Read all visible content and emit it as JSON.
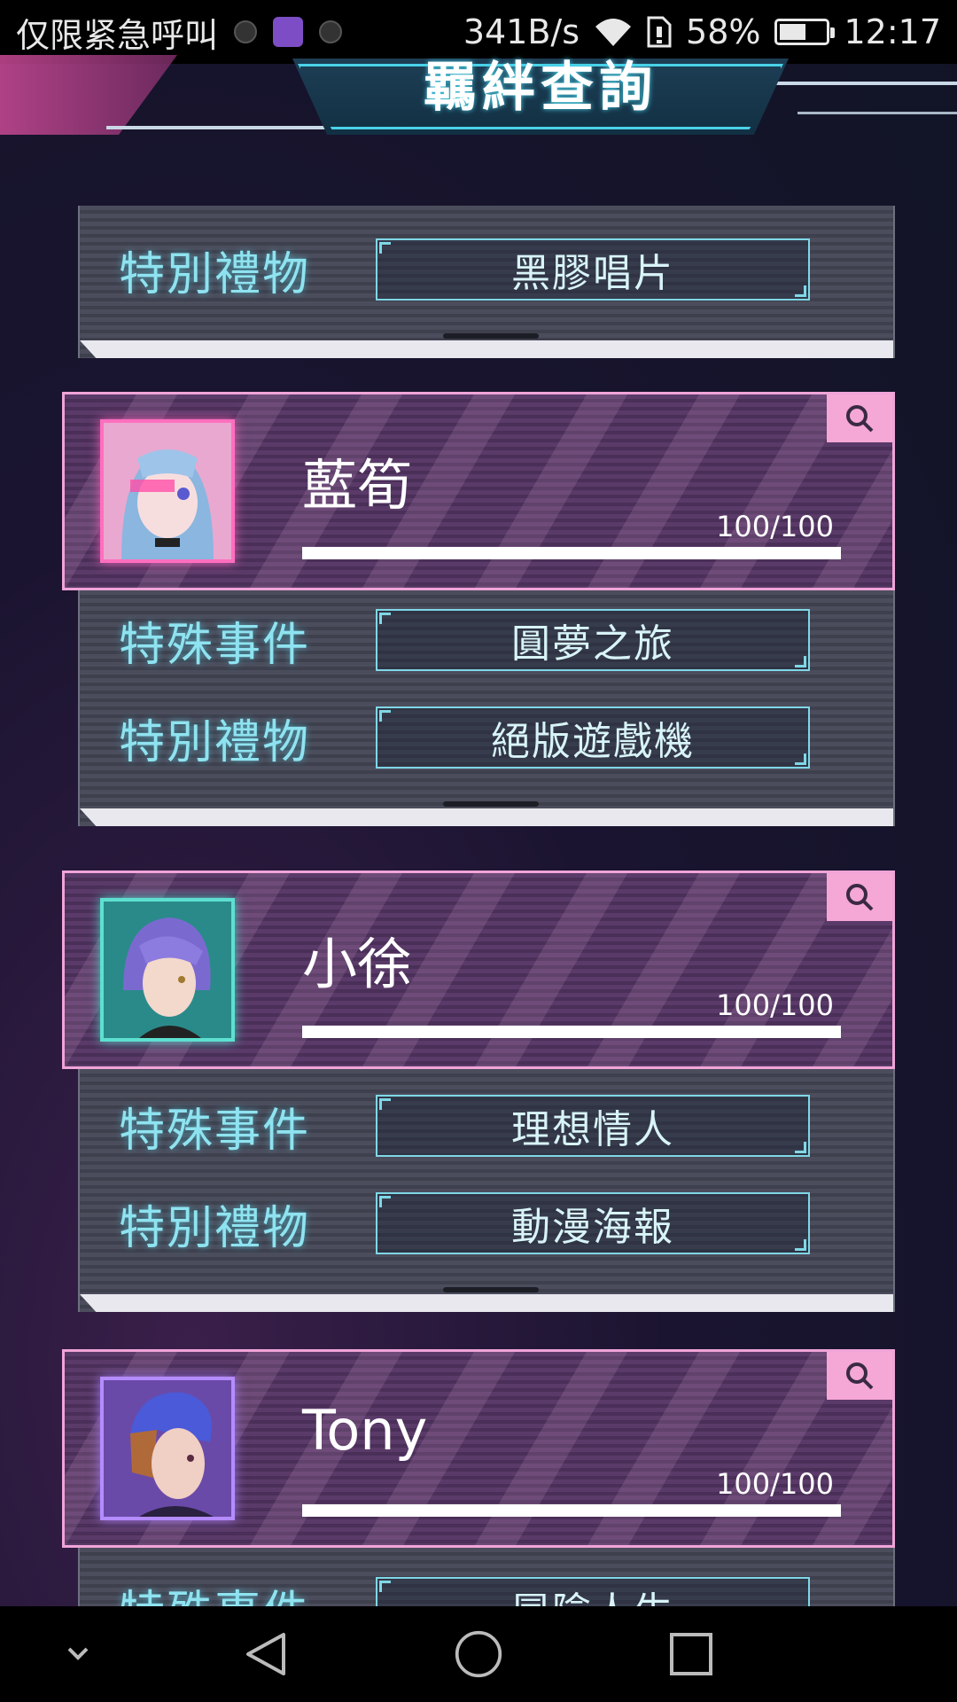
{
  "status_bar": {
    "left_text": "仅限紧急呼叫",
    "speed": "341B/s",
    "battery_percent": "58%",
    "battery_level": 0.58,
    "time": "12:17",
    "icons": [
      "notification-icon",
      "gallery-icon",
      "notification-icon",
      "wifi-icon",
      "sim-icon",
      "battery-icon"
    ]
  },
  "header": {
    "title": "羈絆查詢"
  },
  "top_panel": {
    "gift_label": "特別禮物",
    "gift_value": "黑膠唱片"
  },
  "characters": [
    {
      "name": "藍筍",
      "affinity_text": "100/100",
      "affinity_level": 1.0,
      "event_label": "特殊事件",
      "event_value": "圓夢之旅",
      "gift_label": "特別禮物",
      "gift_value": "絕版遊戲機"
    },
    {
      "name": "小徐",
      "affinity_text": "100/100",
      "affinity_level": 1.0,
      "event_label": "特殊事件",
      "event_value": "理想情人",
      "gift_label": "特別禮物",
      "gift_value": "動漫海報"
    },
    {
      "name": "Tony",
      "affinity_text": "100/100",
      "affinity_level": 1.0,
      "event_label": "特殊事件",
      "event_value": "冒險人生"
    }
  ],
  "colors": {
    "accent_cyan": "#8fe3f0",
    "accent_pink": "#f0a4d8",
    "card_bg": "#5a3a68"
  }
}
